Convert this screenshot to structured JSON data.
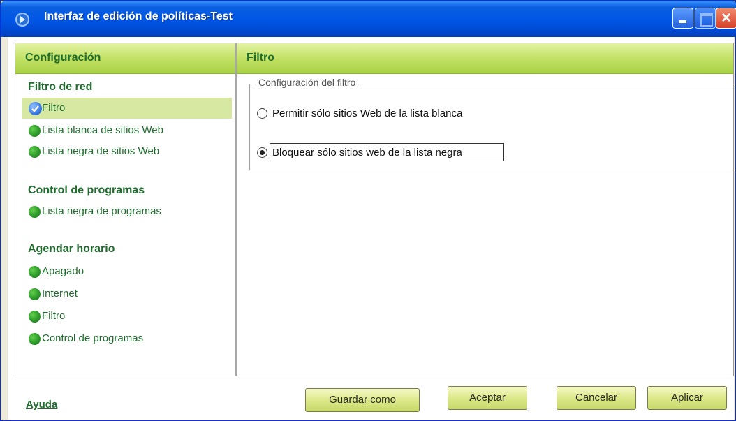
{
  "window": {
    "title": "Interfaz de edición de políticas-Test",
    "close_glyph": "×"
  },
  "left_panel": {
    "header": "Configuración",
    "sections": [
      {
        "title": "Filtro de red",
        "items": [
          {
            "label": "Filtro",
            "selected": true,
            "icon": "check-circle-icon"
          },
          {
            "label": "Lista blanca de sitios Web",
            "icon": "green-dot-icon"
          },
          {
            "label": "Lista negra de sitios Web",
            "icon": "green-dot-icon"
          }
        ]
      },
      {
        "title": "Control de programas",
        "items": [
          {
            "label": "Lista negra de programas",
            "icon": "green-dot-icon"
          }
        ]
      },
      {
        "title": "Agendar horario",
        "items": [
          {
            "label": "Apagado",
            "icon": "green-dot-icon"
          },
          {
            "label": "Internet",
            "icon": "green-dot-icon"
          },
          {
            "label": "Filtro",
            "icon": "green-dot-icon"
          },
          {
            "label": "Control de programas",
            "icon": "green-dot-icon"
          }
        ]
      }
    ]
  },
  "right_panel": {
    "header": "Filtro",
    "group_title": "Configuración del filtro",
    "options": [
      {
        "label": "Permitir sólo sitios Web de la lista blanca",
        "checked": false
      },
      {
        "label": "Bloquear sólo sitios web de la lista negra",
        "checked": true
      }
    ]
  },
  "footer": {
    "help_link": "Ayuda",
    "buttons": {
      "save_as": "Guardar como",
      "accept": "Aceptar",
      "cancel": "Cancelar",
      "apply": "Aplicar"
    }
  },
  "colors": {
    "accent_green": "#1f6e2e",
    "header_gradient_top": "#e4f3a6",
    "header_gradient_bottom": "#a8d145",
    "selected_row": "#d7e8a3",
    "titlebar_blue": "#0055e5"
  }
}
